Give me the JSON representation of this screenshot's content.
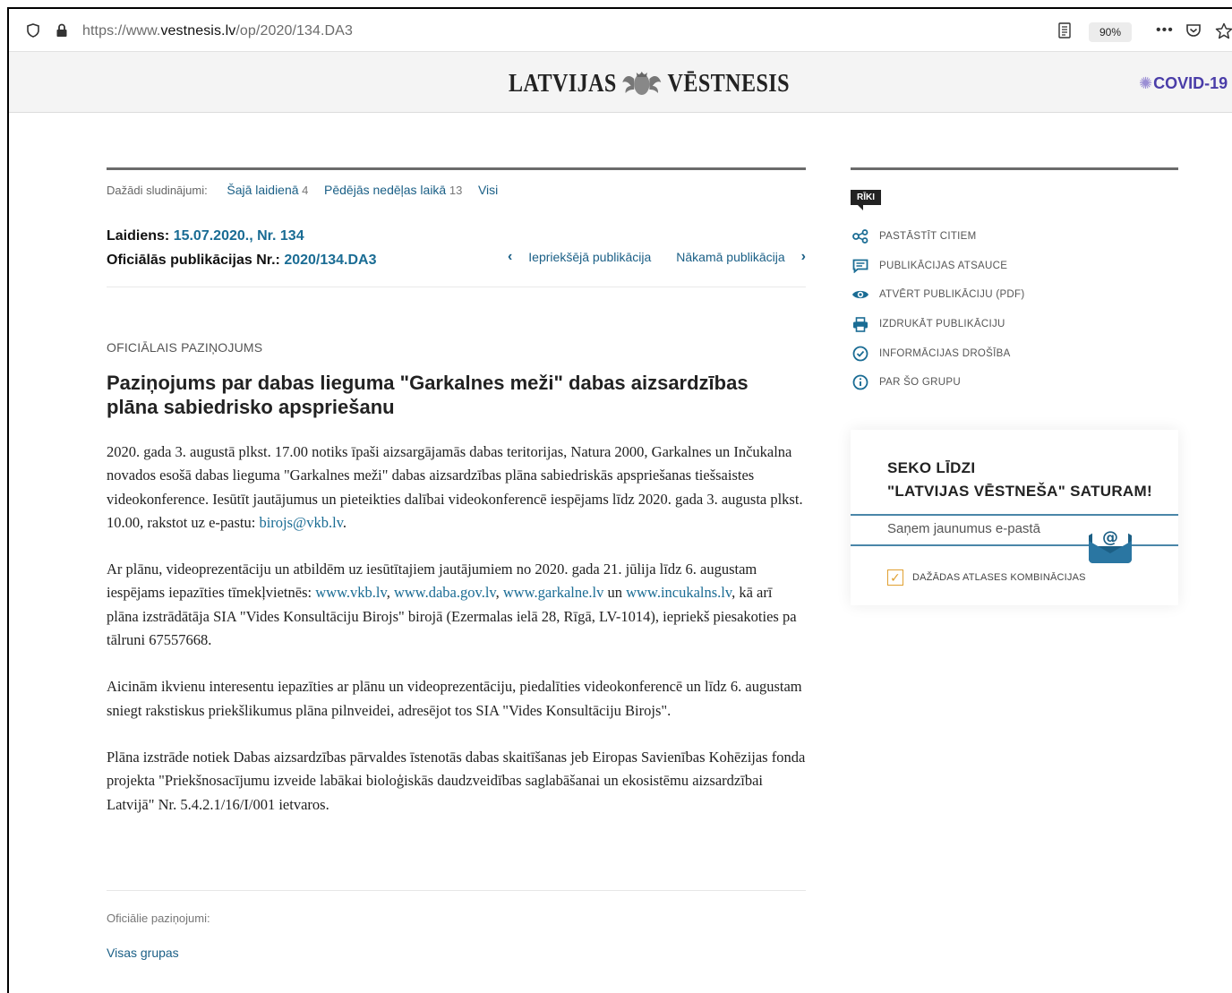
{
  "browser": {
    "url_prefix": "https://www.",
    "url_domain": "vestnesis.lv",
    "url_path": "/op/2020/134.DA3",
    "zoom": "90%"
  },
  "header": {
    "logo_left": "LATVIJAS",
    "logo_right": "VĒSTNESIS",
    "covid": "COVID-19"
  },
  "ads": {
    "label": "Dažādi sludinājumi:",
    "items": [
      {
        "label": "Šajā laidienā",
        "count": "4"
      },
      {
        "label": "Pēdējās nedēļas laikā",
        "count": "13"
      },
      {
        "label": "Visi",
        "count": ""
      }
    ]
  },
  "issue": {
    "issue_label": "Laidiens:",
    "issue_value": "15.07.2020., Nr. 134",
    "pub_label": "Oficiālās publikācijas Nr.:",
    "pub_value": "2020/134.DA3"
  },
  "pubnav": {
    "prev": "Iepriekšējā publikācija",
    "next": "Nākamā publikācija"
  },
  "article": {
    "kicker": "OFICIĀLAIS PAZIŅOJUMS",
    "title": "Paziņojums par dabas lieguma \"Garkalnes meži\" dabas aizsardzības plāna sabiedrisko apspriešanu",
    "p1": "2020. gada 3. augustā plkst. 17.00 notiks īpaši aizsargājamās dabas teritorijas, Natura 2000, Garkalnes un Inčukalna novados esošā dabas lieguma \"Garkalnes meži\" dabas aizsardzības plāna sabiedriskās apspriešanas tiešsaistes videokonference. Iesūtīt jautājumus un pieteikties dalībai videokonferencē iespējams līdz 2020. gada 3. augusta plkst. 10.00, rakstot uz e-pastu: ",
    "p1_link": "birojs@vkb.lv",
    "p1_end": ".",
    "p2a": "Ar plānu, videoprezentāciju un atbildēm uz iesūtītajiem jautājumiem no 2020. gada 21. jūlija līdz 6. augustam iespējams iepazīties tīmekļvietnēs: ",
    "p2_link1": "www.vkb.lv",
    "p2_c1": ", ",
    "p2_link2": "www.daba.gov.lv",
    "p2_c2": ", ",
    "p2_link3": "www.garkalne.lv",
    "p2_c3": " un ",
    "p2_link4": "www.incukalns.lv",
    "p2b": ", kā arī plāna izstrādātāja SIA \"Vides Konsultāciju Birojs\" birojā (Ezermalas ielā 28, Rīgā, LV-1014), iepriekš piesakoties pa tālruni 67557668.",
    "p3": "Aicinām ikvienu interesentu iepazīties ar plānu un videoprezentāciju, piedalīties videokonferencē un līdz 6. augustam sniegt rakstiskus priekšlikumus plāna pilnveidei, adresējot tos SIA \"Vides Konsultāciju Birojs\".",
    "p4": "Plāna izstrāde notiek Dabas aizsardzības pārvaldes īstenotās dabas skaitīšanas jeb Eiropas Savienības Kohēzijas fonda projekta \"Priekšnosacījumu izveide labākai bioloģiskās daudzveidības saglabāšanai un ekosistēmu aizsardzībai Latvijā\" Nr. 5.4.2.1/16/I/001 ietvaros."
  },
  "footer": {
    "groups_label": "Oficiālie paziņojumi:",
    "groups_link": "Visas grupas"
  },
  "sidebar": {
    "tag": "RĪKI",
    "tools": [
      {
        "icon": "share-icon",
        "label": "PASTĀSTĪT CITIEM"
      },
      {
        "icon": "citation-icon",
        "label": "PUBLIKĀCIJAS ATSAUCE"
      },
      {
        "icon": "eye-icon",
        "label": "ATVĒRT PUBLIKĀCIJU (PDF)"
      },
      {
        "icon": "printer-icon",
        "label": "IZDRUKĀT PUBLIKĀCIJU"
      },
      {
        "icon": "check-circle-icon",
        "label": "INFORMĀCIJAS DROŠĪBA"
      },
      {
        "icon": "info-icon",
        "label": "PAR ŠO GRUPU"
      }
    ],
    "follow_line1": "SEKO LĪDZI",
    "follow_line2": "\"LATVIJAS VĒSTNEŠA\" SATURAM!",
    "email_label": "Saņem jaunumus e-pastā",
    "combo_label": "DAŽĀDAS ATLASES KOMBINĀCIJAS"
  },
  "colors": {
    "link": "#1a6c94",
    "covid": "#4a3da8",
    "checkbox": "#e0a030"
  }
}
